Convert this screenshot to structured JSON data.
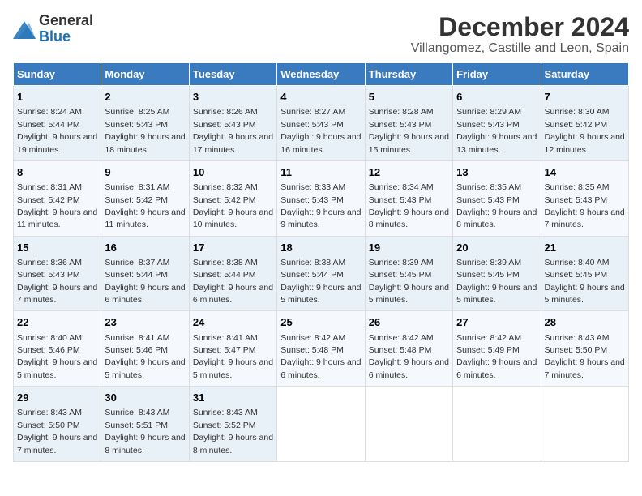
{
  "logo": {
    "general": "General",
    "blue": "Blue"
  },
  "title": {
    "month": "December 2024",
    "location": "Villangomez, Castille and Leon, Spain"
  },
  "headers": [
    "Sunday",
    "Monday",
    "Tuesday",
    "Wednesday",
    "Thursday",
    "Friday",
    "Saturday"
  ],
  "weeks": [
    [
      {
        "day": "1",
        "sunrise": "Sunrise: 8:24 AM",
        "sunset": "Sunset: 5:44 PM",
        "daylight": "Daylight: 9 hours and 19 minutes."
      },
      {
        "day": "2",
        "sunrise": "Sunrise: 8:25 AM",
        "sunset": "Sunset: 5:43 PM",
        "daylight": "Daylight: 9 hours and 18 minutes."
      },
      {
        "day": "3",
        "sunrise": "Sunrise: 8:26 AM",
        "sunset": "Sunset: 5:43 PM",
        "daylight": "Daylight: 9 hours and 17 minutes."
      },
      {
        "day": "4",
        "sunrise": "Sunrise: 8:27 AM",
        "sunset": "Sunset: 5:43 PM",
        "daylight": "Daylight: 9 hours and 16 minutes."
      },
      {
        "day": "5",
        "sunrise": "Sunrise: 8:28 AM",
        "sunset": "Sunset: 5:43 PM",
        "daylight": "Daylight: 9 hours and 15 minutes."
      },
      {
        "day": "6",
        "sunrise": "Sunrise: 8:29 AM",
        "sunset": "Sunset: 5:43 PM",
        "daylight": "Daylight: 9 hours and 13 minutes."
      },
      {
        "day": "7",
        "sunrise": "Sunrise: 8:30 AM",
        "sunset": "Sunset: 5:42 PM",
        "daylight": "Daylight: 9 hours and 12 minutes."
      }
    ],
    [
      {
        "day": "8",
        "sunrise": "Sunrise: 8:31 AM",
        "sunset": "Sunset: 5:42 PM",
        "daylight": "Daylight: 9 hours and 11 minutes."
      },
      {
        "day": "9",
        "sunrise": "Sunrise: 8:31 AM",
        "sunset": "Sunset: 5:42 PM",
        "daylight": "Daylight: 9 hours and 11 minutes."
      },
      {
        "day": "10",
        "sunrise": "Sunrise: 8:32 AM",
        "sunset": "Sunset: 5:42 PM",
        "daylight": "Daylight: 9 hours and 10 minutes."
      },
      {
        "day": "11",
        "sunrise": "Sunrise: 8:33 AM",
        "sunset": "Sunset: 5:43 PM",
        "daylight": "Daylight: 9 hours and 9 minutes."
      },
      {
        "day": "12",
        "sunrise": "Sunrise: 8:34 AM",
        "sunset": "Sunset: 5:43 PM",
        "daylight": "Daylight: 9 hours and 8 minutes."
      },
      {
        "day": "13",
        "sunrise": "Sunrise: 8:35 AM",
        "sunset": "Sunset: 5:43 PM",
        "daylight": "Daylight: 9 hours and 8 minutes."
      },
      {
        "day": "14",
        "sunrise": "Sunrise: 8:35 AM",
        "sunset": "Sunset: 5:43 PM",
        "daylight": "Daylight: 9 hours and 7 minutes."
      }
    ],
    [
      {
        "day": "15",
        "sunrise": "Sunrise: 8:36 AM",
        "sunset": "Sunset: 5:43 PM",
        "daylight": "Daylight: 9 hours and 7 minutes."
      },
      {
        "day": "16",
        "sunrise": "Sunrise: 8:37 AM",
        "sunset": "Sunset: 5:44 PM",
        "daylight": "Daylight: 9 hours and 6 minutes."
      },
      {
        "day": "17",
        "sunrise": "Sunrise: 8:38 AM",
        "sunset": "Sunset: 5:44 PM",
        "daylight": "Daylight: 9 hours and 6 minutes."
      },
      {
        "day": "18",
        "sunrise": "Sunrise: 8:38 AM",
        "sunset": "Sunset: 5:44 PM",
        "daylight": "Daylight: 9 hours and 5 minutes."
      },
      {
        "day": "19",
        "sunrise": "Sunrise: 8:39 AM",
        "sunset": "Sunset: 5:45 PM",
        "daylight": "Daylight: 9 hours and 5 minutes."
      },
      {
        "day": "20",
        "sunrise": "Sunrise: 8:39 AM",
        "sunset": "Sunset: 5:45 PM",
        "daylight": "Daylight: 9 hours and 5 minutes."
      },
      {
        "day": "21",
        "sunrise": "Sunrise: 8:40 AM",
        "sunset": "Sunset: 5:45 PM",
        "daylight": "Daylight: 9 hours and 5 minutes."
      }
    ],
    [
      {
        "day": "22",
        "sunrise": "Sunrise: 8:40 AM",
        "sunset": "Sunset: 5:46 PM",
        "daylight": "Daylight: 9 hours and 5 minutes."
      },
      {
        "day": "23",
        "sunrise": "Sunrise: 8:41 AM",
        "sunset": "Sunset: 5:46 PM",
        "daylight": "Daylight: 9 hours and 5 minutes."
      },
      {
        "day": "24",
        "sunrise": "Sunrise: 8:41 AM",
        "sunset": "Sunset: 5:47 PM",
        "daylight": "Daylight: 9 hours and 5 minutes."
      },
      {
        "day": "25",
        "sunrise": "Sunrise: 8:42 AM",
        "sunset": "Sunset: 5:48 PM",
        "daylight": "Daylight: 9 hours and 6 minutes."
      },
      {
        "day": "26",
        "sunrise": "Sunrise: 8:42 AM",
        "sunset": "Sunset: 5:48 PM",
        "daylight": "Daylight: 9 hours and 6 minutes."
      },
      {
        "day": "27",
        "sunrise": "Sunrise: 8:42 AM",
        "sunset": "Sunset: 5:49 PM",
        "daylight": "Daylight: 9 hours and 6 minutes."
      },
      {
        "day": "28",
        "sunrise": "Sunrise: 8:43 AM",
        "sunset": "Sunset: 5:50 PM",
        "daylight": "Daylight: 9 hours and 7 minutes."
      }
    ],
    [
      {
        "day": "29",
        "sunrise": "Sunrise: 8:43 AM",
        "sunset": "Sunset: 5:50 PM",
        "daylight": "Daylight: 9 hours and 7 minutes."
      },
      {
        "day": "30",
        "sunrise": "Sunrise: 8:43 AM",
        "sunset": "Sunset: 5:51 PM",
        "daylight": "Daylight: 9 hours and 8 minutes."
      },
      {
        "day": "31",
        "sunrise": "Sunrise: 8:43 AM",
        "sunset": "Sunset: 5:52 PM",
        "daylight": "Daylight: 9 hours and 8 minutes."
      },
      null,
      null,
      null,
      null
    ]
  ]
}
